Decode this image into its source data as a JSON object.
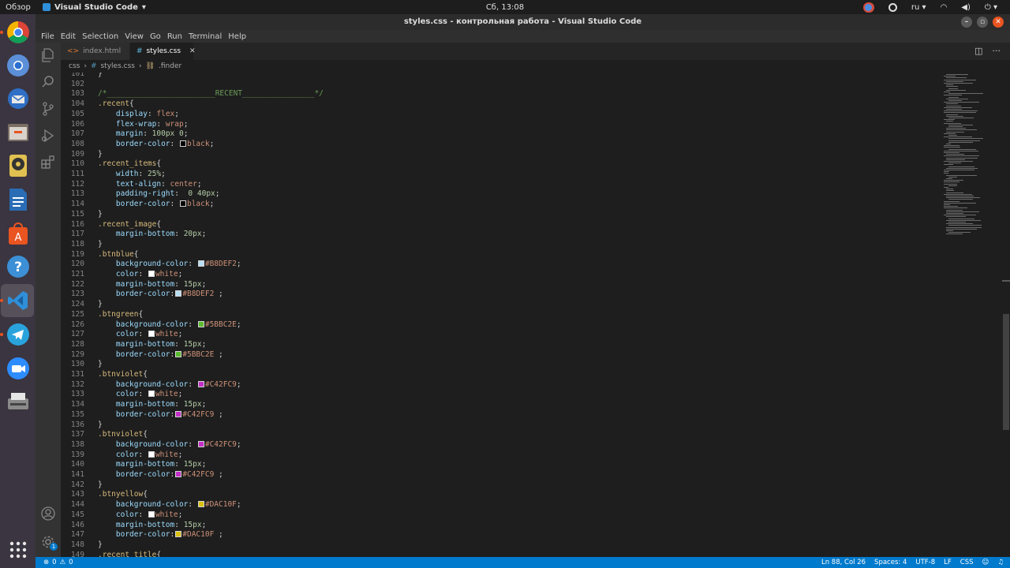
{
  "topbar": {
    "activities": "Обзор",
    "app_name": "Visual Studio Code",
    "clock": "Сб, 13:08",
    "lang": "ru"
  },
  "window": {
    "title": "styles.css - контрольная работа - Visual Studio Code"
  },
  "menu": [
    "File",
    "Edit",
    "Selection",
    "View",
    "Go",
    "Run",
    "Terminal",
    "Help"
  ],
  "tabs": [
    {
      "label": "index.html",
      "icon": "html-icon",
      "active": false
    },
    {
      "label": "styles.css",
      "icon": "css-hash-icon",
      "active": true
    }
  ],
  "breadcrumb": {
    "folder": "css",
    "file": "styles.css",
    "symbol": ".finder"
  },
  "editor_lines": [
    [
      {
        "t": "}",
        "c": "pun"
      }
    ],
    [],
    [
      {
        "t": "/*________________________RECENT________________*/",
        "c": "com"
      }
    ],
    [
      {
        "t": ".recent",
        "c": "sel"
      },
      {
        "t": "{",
        "c": "pun"
      }
    ],
    [
      {
        "t": "    "
      },
      {
        "t": "display",
        "c": "prop"
      },
      {
        "t": ": "
      },
      {
        "t": "flex",
        "c": "val"
      },
      {
        "t": ";"
      }
    ],
    [
      {
        "t": "    "
      },
      {
        "t": "flex-wrap",
        "c": "prop"
      },
      {
        "t": ": "
      },
      {
        "t": "wrap",
        "c": "val"
      },
      {
        "t": ";"
      }
    ],
    [
      {
        "t": "    "
      },
      {
        "t": "margin",
        "c": "prop"
      },
      {
        "t": ": "
      },
      {
        "t": "100px",
        "c": "num"
      },
      {
        "t": " "
      },
      {
        "t": "0",
        "c": "num"
      },
      {
        "t": ";"
      }
    ],
    [
      {
        "t": "    "
      },
      {
        "t": "border-color",
        "c": "prop"
      },
      {
        "t": ": "
      },
      {
        "sw": "#000000"
      },
      {
        "t": "black",
        "c": "val"
      },
      {
        "t": ";"
      }
    ],
    [
      {
        "t": "}"
      }
    ],
    [
      {
        "t": ".recent_items",
        "c": "sel"
      },
      {
        "t": "{"
      }
    ],
    [
      {
        "t": "    "
      },
      {
        "t": "width",
        "c": "prop"
      },
      {
        "t": ": "
      },
      {
        "t": "25%",
        "c": "num"
      },
      {
        "t": ";"
      }
    ],
    [
      {
        "t": "    "
      },
      {
        "t": "text-align",
        "c": "prop"
      },
      {
        "t": ": "
      },
      {
        "t": "center",
        "c": "val"
      },
      {
        "t": ";"
      }
    ],
    [
      {
        "t": "    "
      },
      {
        "t": "padding-right",
        "c": "prop"
      },
      {
        "t": ":  "
      },
      {
        "t": "0",
        "c": "num"
      },
      {
        "t": " "
      },
      {
        "t": "40px",
        "c": "num"
      },
      {
        "t": ";"
      }
    ],
    [
      {
        "t": "    "
      },
      {
        "t": "border-color",
        "c": "prop"
      },
      {
        "t": ": "
      },
      {
        "sw": "#000000"
      },
      {
        "t": "black",
        "c": "val"
      },
      {
        "t": ";"
      }
    ],
    [
      {
        "t": "}"
      }
    ],
    [
      {
        "t": ".recent_image",
        "c": "sel"
      },
      {
        "t": "{"
      }
    ],
    [
      {
        "t": "    "
      },
      {
        "t": "margin-bottom",
        "c": "prop"
      },
      {
        "t": ": "
      },
      {
        "t": "20px",
        "c": "num"
      },
      {
        "t": ";"
      }
    ],
    [
      {
        "t": "}"
      }
    ],
    [
      {
        "t": ".btnblue",
        "c": "sel"
      },
      {
        "t": "{"
      }
    ],
    [
      {
        "t": "    "
      },
      {
        "t": "background-color",
        "c": "prop"
      },
      {
        "t": ": "
      },
      {
        "sw": "#B8DEF2"
      },
      {
        "t": "#B8DEF2",
        "c": "val"
      },
      {
        "t": ";"
      }
    ],
    [
      {
        "t": "    "
      },
      {
        "t": "color",
        "c": "prop"
      },
      {
        "t": ": "
      },
      {
        "sw": "#FFFFFF"
      },
      {
        "t": "white",
        "c": "val"
      },
      {
        "t": ";"
      }
    ],
    [
      {
        "t": "    "
      },
      {
        "t": "margin-bottom",
        "c": "prop"
      },
      {
        "t": ": "
      },
      {
        "t": "15px",
        "c": "num"
      },
      {
        "t": ";"
      }
    ],
    [
      {
        "t": "    "
      },
      {
        "t": "border-color",
        "c": "prop"
      },
      {
        "t": ":"
      },
      {
        "sw": "#B8DEF2"
      },
      {
        "t": "#B8DEF2",
        "c": "val"
      },
      {
        "t": " ;"
      }
    ],
    [
      {
        "t": "}"
      }
    ],
    [
      {
        "t": ".btngreen",
        "c": "sel"
      },
      {
        "t": "{"
      }
    ],
    [
      {
        "t": "    "
      },
      {
        "t": "background-color",
        "c": "prop"
      },
      {
        "t": ": "
      },
      {
        "sw": "#5BBC2E"
      },
      {
        "t": "#5BBC2E",
        "c": "val"
      },
      {
        "t": ";"
      }
    ],
    [
      {
        "t": "    "
      },
      {
        "t": "color",
        "c": "prop"
      },
      {
        "t": ": "
      },
      {
        "sw": "#FFFFFF"
      },
      {
        "t": "white",
        "c": "val"
      },
      {
        "t": ";"
      }
    ],
    [
      {
        "t": "    "
      },
      {
        "t": "margin-bottom",
        "c": "prop"
      },
      {
        "t": ": "
      },
      {
        "t": "15px",
        "c": "num"
      },
      {
        "t": ";"
      }
    ],
    [
      {
        "t": "    "
      },
      {
        "t": "border-color",
        "c": "prop"
      },
      {
        "t": ":"
      },
      {
        "sw": "#5BBC2E"
      },
      {
        "t": "#5BBC2E",
        "c": "val"
      },
      {
        "t": " ;"
      }
    ],
    [
      {
        "t": "}"
      }
    ],
    [
      {
        "t": ".btnviolet",
        "c": "sel"
      },
      {
        "t": "{"
      }
    ],
    [
      {
        "t": "    "
      },
      {
        "t": "background-color",
        "c": "prop"
      },
      {
        "t": ": "
      },
      {
        "sw": "#C42FC9"
      },
      {
        "t": "#C42FC9",
        "c": "val"
      },
      {
        "t": ";"
      }
    ],
    [
      {
        "t": "    "
      },
      {
        "t": "color",
        "c": "prop"
      },
      {
        "t": ": "
      },
      {
        "sw": "#FFFFFF"
      },
      {
        "t": "white",
        "c": "val"
      },
      {
        "t": ";"
      }
    ],
    [
      {
        "t": "    "
      },
      {
        "t": "margin-bottom",
        "c": "prop"
      },
      {
        "t": ": "
      },
      {
        "t": "15px",
        "c": "num"
      },
      {
        "t": ";"
      }
    ],
    [
      {
        "t": "    "
      },
      {
        "t": "border-color",
        "c": "prop"
      },
      {
        "t": ":"
      },
      {
        "sw": "#C42FC9"
      },
      {
        "t": "#C42FC9",
        "c": "val"
      },
      {
        "t": " ;"
      }
    ],
    [
      {
        "t": "}"
      }
    ],
    [
      {
        "t": ".btnviolet",
        "c": "sel"
      },
      {
        "t": "{"
      }
    ],
    [
      {
        "t": "    "
      },
      {
        "t": "background-color",
        "c": "prop"
      },
      {
        "t": ": "
      },
      {
        "sw": "#C42FC9"
      },
      {
        "t": "#C42FC9",
        "c": "val"
      },
      {
        "t": ";"
      }
    ],
    [
      {
        "t": "    "
      },
      {
        "t": "color",
        "c": "prop"
      },
      {
        "t": ": "
      },
      {
        "sw": "#FFFFFF"
      },
      {
        "t": "white",
        "c": "val"
      },
      {
        "t": ";"
      }
    ],
    [
      {
        "t": "    "
      },
      {
        "t": "margin-bottom",
        "c": "prop"
      },
      {
        "t": ": "
      },
      {
        "t": "15px",
        "c": "num"
      },
      {
        "t": ";"
      }
    ],
    [
      {
        "t": "    "
      },
      {
        "t": "border-color",
        "c": "prop"
      },
      {
        "t": ":"
      },
      {
        "sw": "#C42FC9"
      },
      {
        "t": "#C42FC9",
        "c": "val"
      },
      {
        "t": " ;"
      }
    ],
    [
      {
        "t": "}"
      }
    ],
    [
      {
        "t": ".btnyellow",
        "c": "sel"
      },
      {
        "t": "{"
      }
    ],
    [
      {
        "t": "    "
      },
      {
        "t": "background-color",
        "c": "prop"
      },
      {
        "t": ": "
      },
      {
        "sw": "#DAC10F"
      },
      {
        "t": "#DAC10F",
        "c": "val"
      },
      {
        "t": ";"
      }
    ],
    [
      {
        "t": "    "
      },
      {
        "t": "color",
        "c": "prop"
      },
      {
        "t": ": "
      },
      {
        "sw": "#FFFFFF"
      },
      {
        "t": "white",
        "c": "val"
      },
      {
        "t": ";"
      }
    ],
    [
      {
        "t": "    "
      },
      {
        "t": "margin-bottom",
        "c": "prop"
      },
      {
        "t": ": "
      },
      {
        "t": "15px",
        "c": "num"
      },
      {
        "t": ";"
      }
    ],
    [
      {
        "t": "    "
      },
      {
        "t": "border-color",
        "c": "prop"
      },
      {
        "t": ":"
      },
      {
        "sw": "#DAC10F"
      },
      {
        "t": "#DAC10F",
        "c": "val"
      },
      {
        "t": " ;"
      }
    ],
    [
      {
        "t": "}"
      }
    ],
    [
      {
        "t": ".recent_title",
        "c": "sel"
      },
      {
        "t": "{"
      }
    ]
  ],
  "line_numbers": [
    "101",
    "102",
    "103",
    "104",
    "105",
    "106",
    "107",
    "108",
    "109",
    "110",
    "111",
    "112",
    "113",
    "114",
    "115",
    "116",
    "117",
    "118",
    "119",
    "120",
    "121",
    "122",
    "123",
    "124",
    "125",
    "126",
    "127",
    "128",
    "129",
    "130",
    "131",
    "132",
    "133",
    "134",
    "135",
    "136",
    "137",
    "138",
    "139",
    "140",
    "141",
    "142",
    "143",
    "144",
    "145",
    "146",
    "147",
    "148",
    "149"
  ],
  "status": {
    "errors": "0",
    "warnings": "0",
    "position": "Ln 88, Col 26",
    "spaces": "Spaces: 4",
    "encoding": "UTF-8",
    "eol": "LF",
    "language": "CSS"
  },
  "dock_apps": [
    "chrome-icon",
    "chromium-icon",
    "thunderbird-icon",
    "files-icon",
    "rhythmbox-icon",
    "libreoffice-writer-icon",
    "software-center-icon",
    "help-icon",
    "vscode-icon",
    "telegram-icon",
    "zoom-icon",
    "scanner-icon"
  ],
  "activity_badge": "1",
  "colors": {
    "accent": "#007acc",
    "ubuntu_orange": "#e95420"
  }
}
